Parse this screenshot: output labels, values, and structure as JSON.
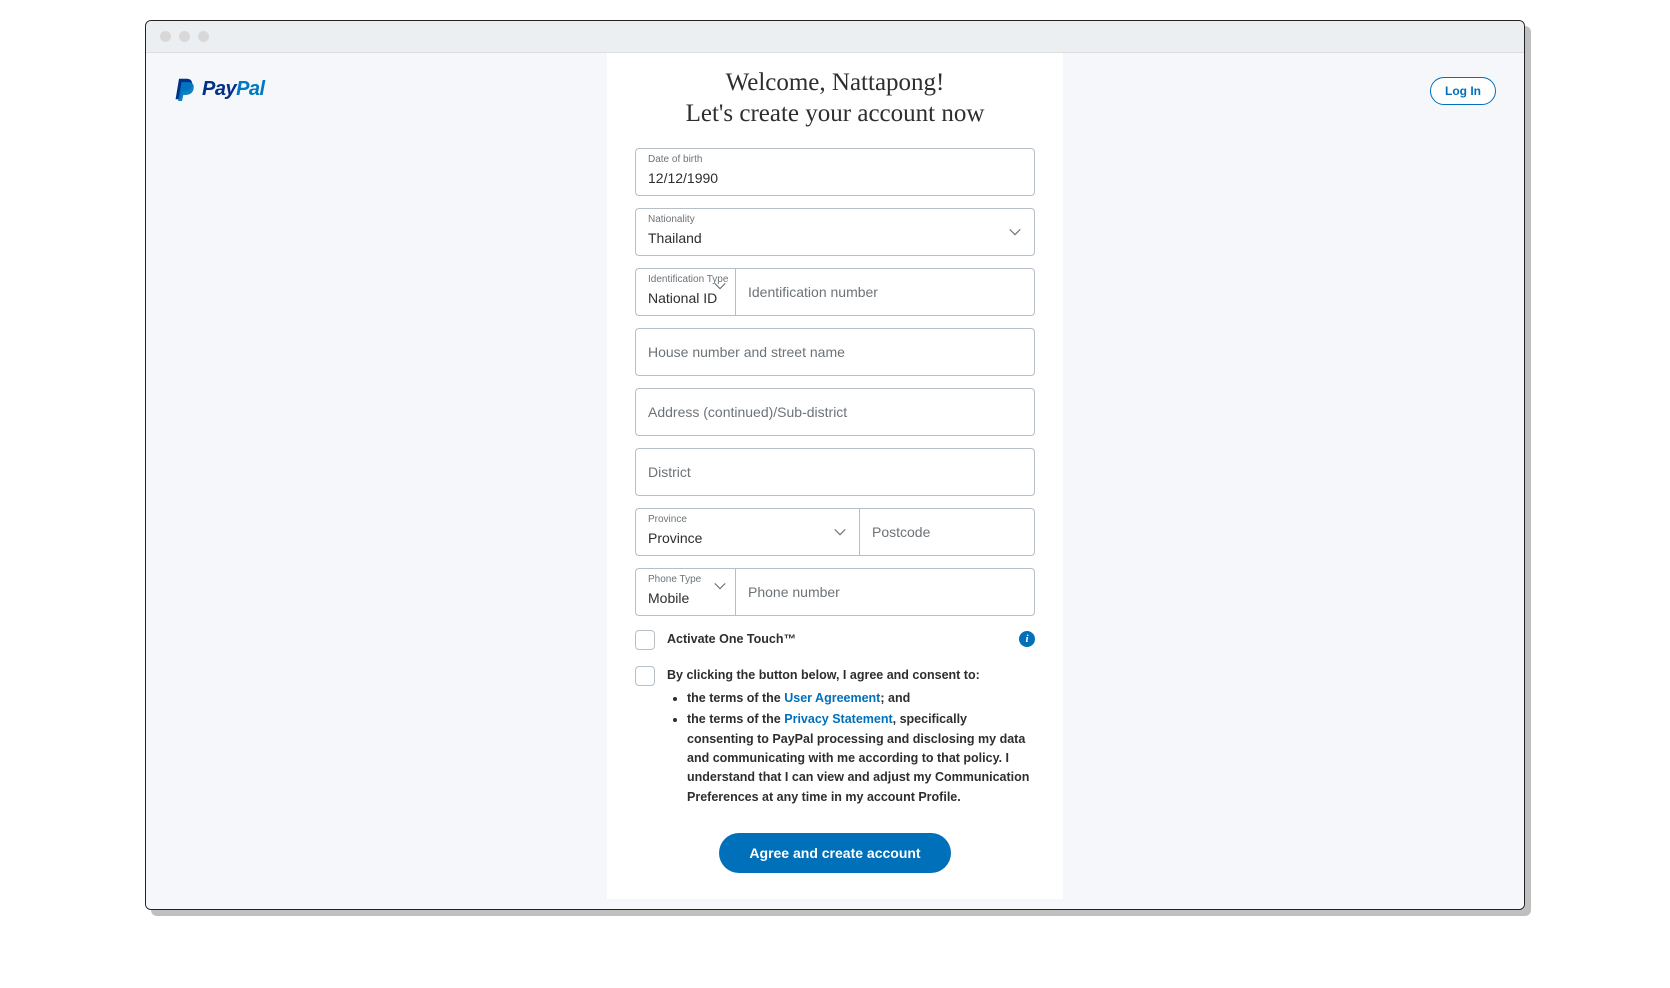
{
  "header": {
    "brand_p1": "Pay",
    "brand_p2": "Pal",
    "login_label": "Log In"
  },
  "form": {
    "heading_line1": "Welcome, Nattapong!",
    "heading_line2": "Let's create your account now",
    "dob": {
      "label": "Date of birth",
      "value": "12/12/1990"
    },
    "nationality": {
      "label": "Nationality",
      "value": "Thailand"
    },
    "id_type": {
      "label": "Identification Type",
      "value": "National ID"
    },
    "id_number": {
      "placeholder": "Identification number"
    },
    "address1": {
      "placeholder": "House number and street name"
    },
    "address2": {
      "placeholder": "Address (continued)/Sub-district"
    },
    "district": {
      "placeholder": "District"
    },
    "province": {
      "label": "Province",
      "value": "Province"
    },
    "postcode": {
      "placeholder": "Postcode"
    },
    "phone_type": {
      "label": "Phone Type",
      "value": "Mobile"
    },
    "phone_number": {
      "placeholder": "Phone number"
    },
    "one_touch_label": "Activate One Touch™",
    "info_glyph": "i",
    "consent_intro": "By clicking the button below, I agree and consent to:",
    "consent_item1_pre": "the terms of the ",
    "consent_item1_link": "User Agreement",
    "consent_item1_post": "; and",
    "consent_item2_pre": "the terms of the ",
    "consent_item2_link": "Privacy Statement",
    "consent_item2_post": ", specifically consenting to PayPal processing and disclosing my data and communicating with me according to that policy. I understand that I can view and adjust my Communication Preferences at any time in my account Profile.",
    "submit_label": "Agree and create account"
  }
}
